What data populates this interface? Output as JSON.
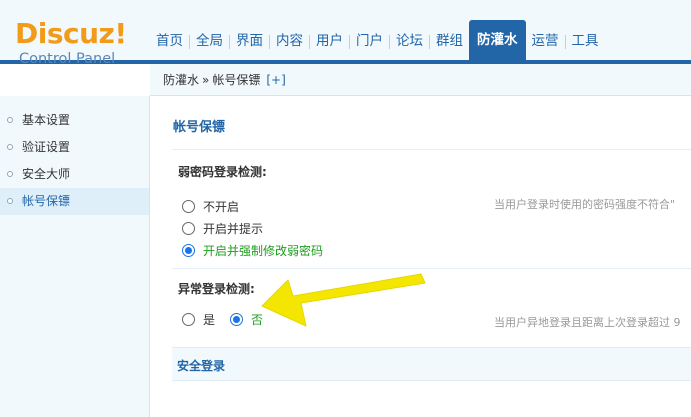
{
  "logo": {
    "main": "Discuz",
    "bang": "!",
    "sub": "Control Panel"
  },
  "nav": {
    "items": [
      {
        "label": "首页"
      },
      {
        "label": "全局"
      },
      {
        "label": "界面"
      },
      {
        "label": "内容"
      },
      {
        "label": "用户"
      },
      {
        "label": "门户"
      },
      {
        "label": "论坛"
      },
      {
        "label": "群组"
      },
      {
        "label": "防灌水",
        "active": true
      },
      {
        "label": "运营"
      },
      {
        "label": "工具"
      }
    ]
  },
  "breadcrumb": {
    "section": "防灌水",
    "separator": "»",
    "page": "帐号保镖",
    "plus": "[+]"
  },
  "sidebar": {
    "items": [
      {
        "label": "基本设置"
      },
      {
        "label": "验证设置"
      },
      {
        "label": "安全大师"
      },
      {
        "label": "帐号保镖",
        "active": true
      }
    ]
  },
  "main": {
    "title": "帐号保镖",
    "weak_password": {
      "title": "弱密码登录检测:",
      "options": [
        "不开启",
        "开启并提示",
        "开启并强制修改弱密码"
      ],
      "selected": 2,
      "tip": "当用户登录时使用的密码强度不符合\""
    },
    "abnormal_login": {
      "title": "异常登录检测:",
      "options": [
        "是",
        "否"
      ],
      "selected": 1,
      "tip": "当用户异地登录且距离上次登录超过 9"
    },
    "secure_login": {
      "title": "安全登录"
    }
  },
  "colors": {
    "accent": "#2366a8",
    "logo": "#f29b1b",
    "checked_label": "#1e9d1e",
    "annotation_arrow": "#f4e600"
  },
  "annotation": {
    "icon": "arrow-icon"
  }
}
